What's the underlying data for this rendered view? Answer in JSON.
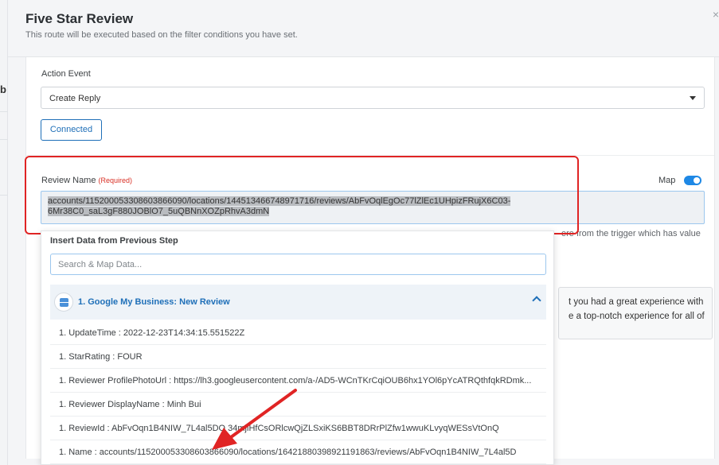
{
  "modal": {
    "title": "Five Star Review",
    "subtitle": "This route will be executed based on the filter conditions you have set.",
    "close_icon": "close-icon"
  },
  "background": {
    "letter": "b"
  },
  "action_event": {
    "label": "Action Event",
    "value": "Create Reply"
  },
  "connected_button": "Connected",
  "review_name": {
    "label": "Review Name",
    "required": "(Required)",
    "value_line1": "accounts/115200053308603866090/locations/144513466748971716/reviews/AbFvOqlEgOc77lZlEc1UHpizFRujX6C03-",
    "value_line2": "6Mr38C0_saL3gF880JOBlO7_5uQBNnXOZpRhvA3dmN"
  },
  "map": {
    "label": "Map",
    "enabled": true
  },
  "hint_text": "ere from the trigger which has value",
  "side_box": {
    "line1": "t you had a great experience with",
    "line2": "e a top-notch experience for all of"
  },
  "dropdown": {
    "title": "Insert Data from Previous Step",
    "search_placeholder": "Search & Map Data...",
    "group_label": "1. Google My Business: New Review",
    "items": [
      "1. UpdateTime : 2022-12-23T14:34:15.551522Z",
      "1. StarRating : FOUR",
      "1. Reviewer ProfilePhotoUrl : https://lh3.googleusercontent.com/a-/AD5-WCnTKrCqiOUB6hx1YOl6pYcATRQthfqkRDmk...",
      "1. Reviewer DisplayName : Minh Bui",
      "1. ReviewId : AbFvOqn1B4NIW_7L4al5DO  34mjiHfCsORlcwQjZLSxiKS6BBT8DRrPlZfw1wwuKLvyqWESsVtOnQ",
      "1. Name : accounts/115200053308603866090/locations/16421880398921191863/reviews/AbFvOqn1B4NIW_7L4al5D"
    ]
  },
  "colors": {
    "accent": "#1e6fb8",
    "annotation": "#e02424"
  }
}
